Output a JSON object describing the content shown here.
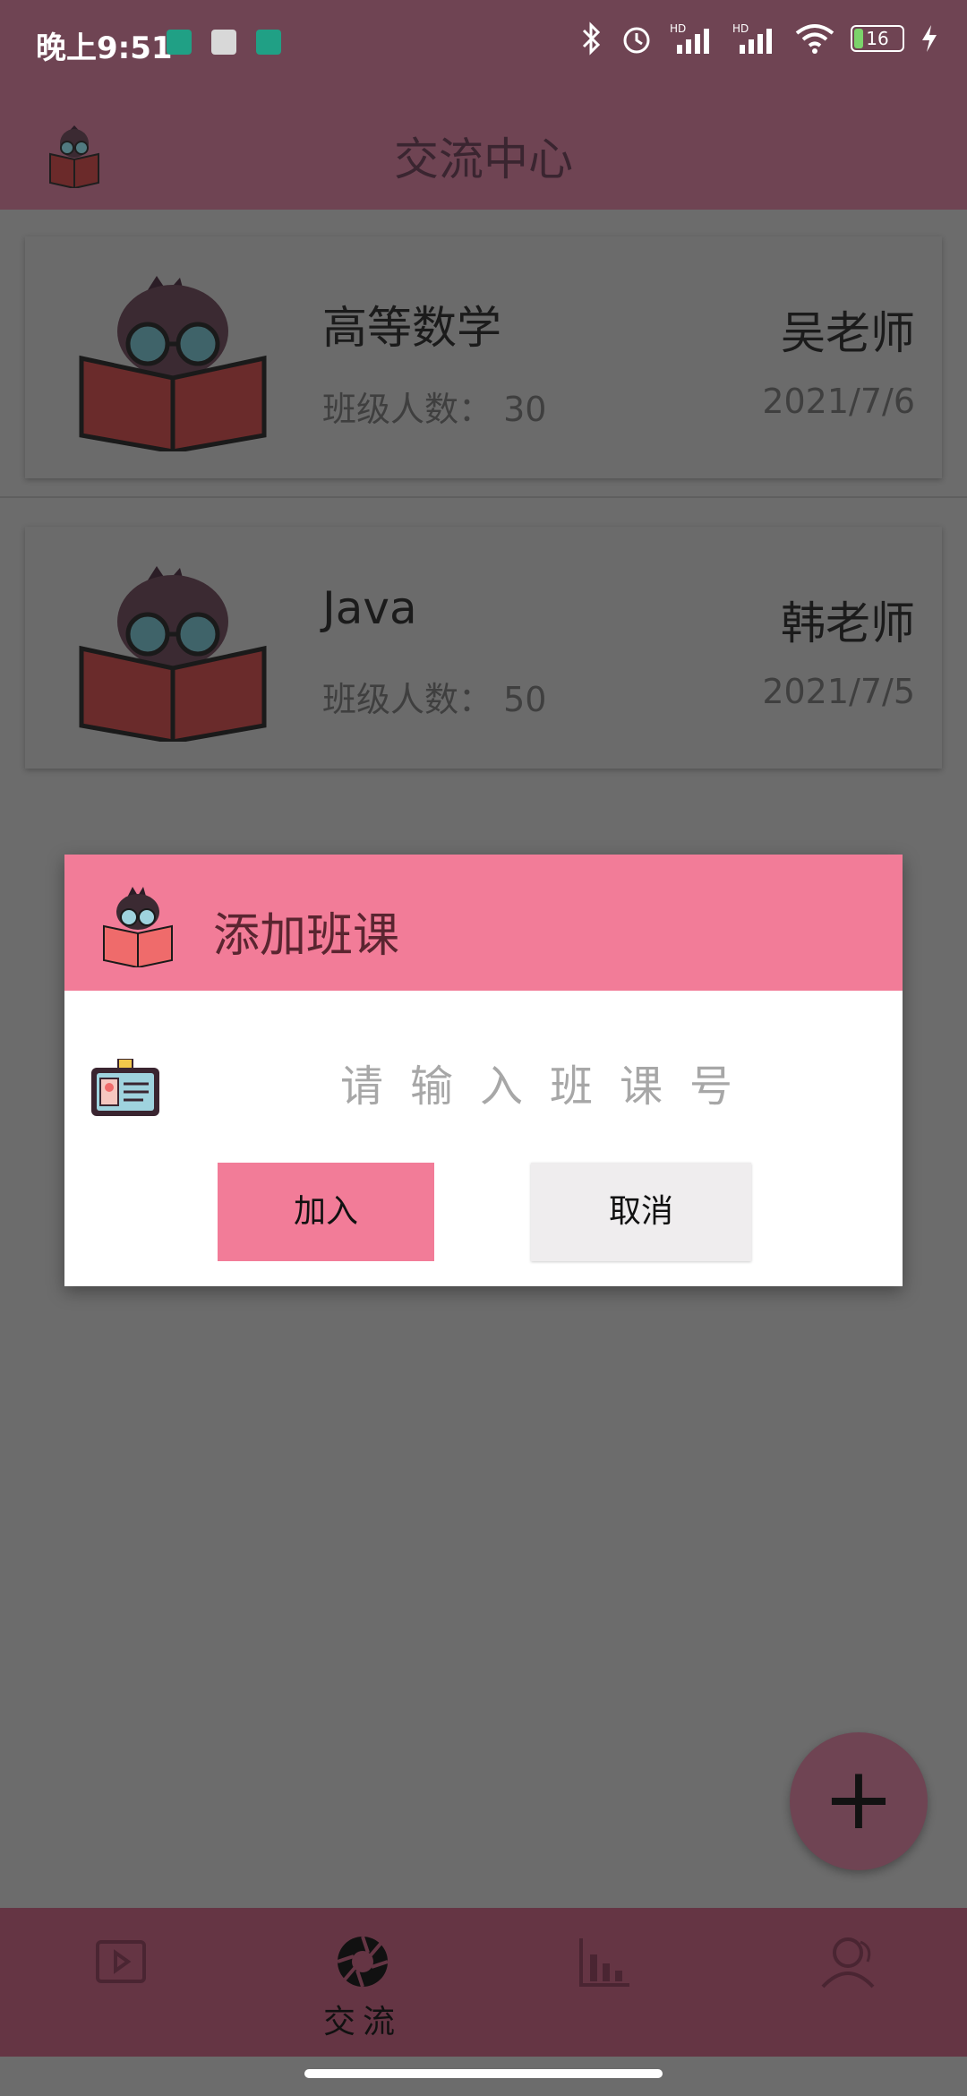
{
  "status": {
    "time": "晚上9:51",
    "battery": "16",
    "hd1": "HD",
    "hd2": "HD"
  },
  "appbar": {
    "title": "交流中心"
  },
  "courses": [
    {
      "name": "高等数学",
      "count_label": "班级人数：",
      "count": "30",
      "teacher": "吴老师",
      "date": "2021/7/6"
    },
    {
      "name": "Java",
      "count_label": "班级人数：",
      "count": "50",
      "teacher": "韩老师",
      "date": "2021/7/5"
    }
  ],
  "dialog": {
    "title": "添加班课",
    "input_placeholder": "请输入班课号",
    "join_label": "加入",
    "cancel_label": "取消"
  },
  "fab": {
    "label": "+"
  },
  "bottom_nav": [
    {
      "icon": "video-icon",
      "label": ""
    },
    {
      "icon": "aperture-icon",
      "label": "交流"
    },
    {
      "icon": "bar-chart-icon",
      "label": ""
    },
    {
      "icon": "user-icon",
      "label": ""
    }
  ],
  "colors": {
    "primary": "#6f4453",
    "accent": "#f27c98",
    "overlay": "#6c6c6c"
  }
}
